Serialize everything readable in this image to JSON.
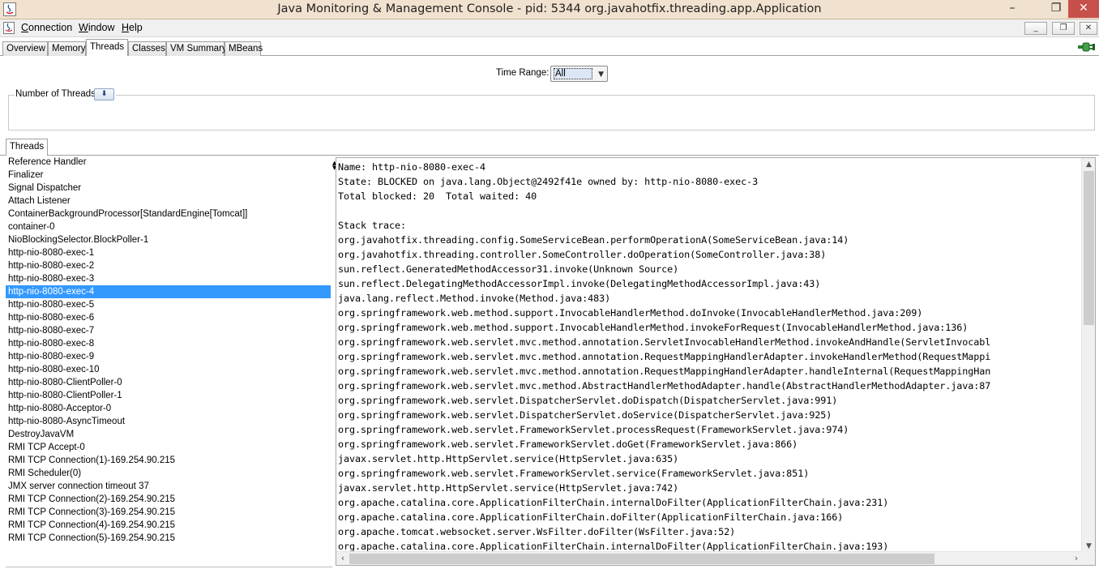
{
  "window": {
    "title": "Java Monitoring & Management Console - pid: 5344 org.javahotfix.threading.app.Application",
    "minimize_label": "–",
    "restore_label": "❐",
    "close_label": "✕"
  },
  "menu": [
    {
      "mnemonic": "C",
      "rest": "onnection"
    },
    {
      "mnemonic": "W",
      "rest": "indow"
    },
    {
      "mnemonic": "H",
      "rest": "elp"
    }
  ],
  "mdi_controls": {
    "minimize": "_",
    "restore": "❐",
    "close": "✕"
  },
  "tabs": [
    {
      "label": "Overview"
    },
    {
      "label": "Memory"
    },
    {
      "label": "Threads",
      "active": true
    },
    {
      "label": "Classes"
    },
    {
      "label": "VM Summary"
    },
    {
      "label": "MBeans"
    }
  ],
  "time_range": {
    "label": "Time Range:",
    "value": "All"
  },
  "number_of_threads": {
    "label": "Number of Threads",
    "button": "⬇"
  },
  "threads_panel": {
    "tab_label": "Threads"
  },
  "threads": [
    "Reference Handler",
    "Finalizer",
    "Signal Dispatcher",
    "Attach Listener",
    "ContainerBackgroundProcessor[StandardEngine[Tomcat]]",
    "container-0",
    "NioBlockingSelector.BlockPoller-1",
    "http-nio-8080-exec-1",
    "http-nio-8080-exec-2",
    "http-nio-8080-exec-3",
    "http-nio-8080-exec-4",
    "http-nio-8080-exec-5",
    "http-nio-8080-exec-6",
    "http-nio-8080-exec-7",
    "http-nio-8080-exec-8",
    "http-nio-8080-exec-9",
    "http-nio-8080-exec-10",
    "http-nio-8080-ClientPoller-0",
    "http-nio-8080-ClientPoller-1",
    "http-nio-8080-Acceptor-0",
    "http-nio-8080-AsyncTimeout",
    "DestroyJavaVM",
    "RMI TCP Accept-0",
    "RMI TCP Connection(1)-169.254.90.215",
    "RMI Scheduler(0)",
    "JMX server connection timeout 37",
    "RMI TCP Connection(2)-169.254.90.215",
    "RMI TCP Connection(3)-169.254.90.215",
    "RMI TCP Connection(4)-169.254.90.215",
    "RMI TCP Connection(5)-169.254.90.215"
  ],
  "selected_thread": "http-nio-8080-exec-4",
  "details": [
    "Name: http-nio-8080-exec-4",
    "State: BLOCKED on java.lang.Object@2492f41e owned by: http-nio-8080-exec-3",
    "Total blocked: 20  Total waited: 40",
    "",
    "Stack trace:",
    "org.javahotfix.threading.config.SomeServiceBean.performOperationA(SomeServiceBean.java:14)",
    "org.javahotfix.threading.controller.SomeController.doOperation(SomeController.java:38)",
    "sun.reflect.GeneratedMethodAccessor31.invoke(Unknown Source)",
    "sun.reflect.DelegatingMethodAccessorImpl.invoke(DelegatingMethodAccessorImpl.java:43)",
    "java.lang.reflect.Method.invoke(Method.java:483)",
    "org.springframework.web.method.support.InvocableHandlerMethod.doInvoke(InvocableHandlerMethod.java:209)",
    "org.springframework.web.method.support.InvocableHandlerMethod.invokeForRequest(InvocableHandlerMethod.java:136)",
    "org.springframework.web.servlet.mvc.method.annotation.ServletInvocableHandlerMethod.invokeAndHandle(ServletInvocabl",
    "org.springframework.web.servlet.mvc.method.annotation.RequestMappingHandlerAdapter.invokeHandlerMethod(RequestMappi",
    "org.springframework.web.servlet.mvc.method.annotation.RequestMappingHandlerAdapter.handleInternal(RequestMappingHan",
    "org.springframework.web.servlet.mvc.method.AbstractHandlerMethodAdapter.handle(AbstractHandlerMethodAdapter.java:87",
    "org.springframework.web.servlet.DispatcherServlet.doDispatch(DispatcherServlet.java:991)",
    "org.springframework.web.servlet.DispatcherServlet.doService(DispatcherServlet.java:925)",
    "org.springframework.web.servlet.FrameworkServlet.processRequest(FrameworkServlet.java:974)",
    "org.springframework.web.servlet.FrameworkServlet.doGet(FrameworkServlet.java:866)",
    "javax.servlet.http.HttpServlet.service(HttpServlet.java:635)",
    "org.springframework.web.servlet.FrameworkServlet.service(FrameworkServlet.java:851)",
    "javax.servlet.http.HttpServlet.service(HttpServlet.java:742)",
    "org.apache.catalina.core.ApplicationFilterChain.internalDoFilter(ApplicationFilterChain.java:231)",
    "org.apache.catalina.core.ApplicationFilterChain.doFilter(ApplicationFilterChain.java:166)",
    "org.apache.tomcat.websocket.server.WsFilter.doFilter(WsFilter.java:52)",
    "org.apache.catalina.core.ApplicationFilterChain.internalDoFilter(ApplicationFilterChain.java:193)"
  ],
  "colors": {
    "selection": "#3399ff",
    "titlebar": "#f1e1cf",
    "close_button": "#c7504a"
  }
}
